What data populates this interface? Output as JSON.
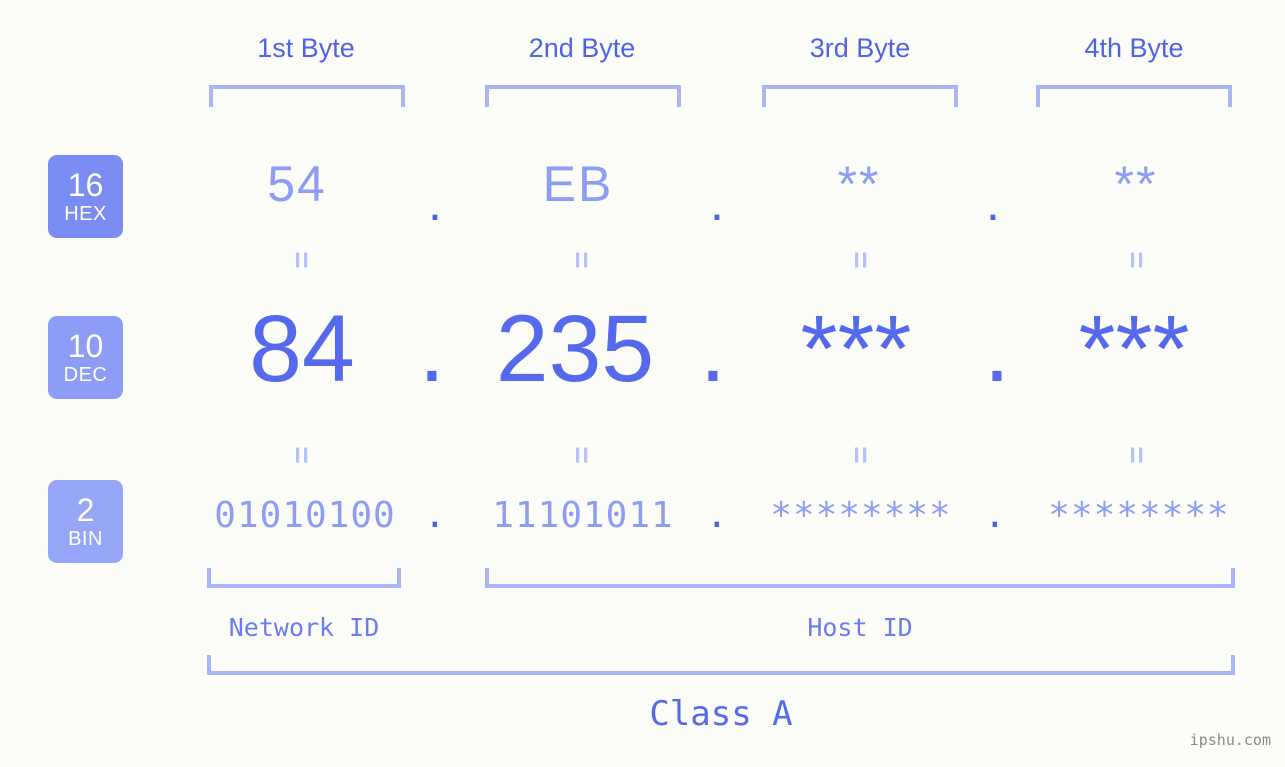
{
  "meta": {
    "background_color": "#fcfdf8",
    "accent_color": "#5569ec",
    "accent_light": "#8d9cf4",
    "bracket_color": "#aab4f7",
    "watermark": "ipshu.com"
  },
  "byte_headers": [
    {
      "label": "1st Byte"
    },
    {
      "label": "2nd Byte"
    },
    {
      "label": "3rd Byte"
    },
    {
      "label": "4th Byte"
    }
  ],
  "bases": [
    {
      "number": "16",
      "name": "HEX",
      "color": "#7b8cf2"
    },
    {
      "number": "10",
      "name": "DEC",
      "color": "#8d9cf4"
    },
    {
      "number": "2",
      "name": "BIN",
      "color": "#96a6f6"
    }
  ],
  "rows": {
    "hex": {
      "values": [
        "54",
        "EB",
        "**",
        "**"
      ],
      "separator": "."
    },
    "dec": {
      "values": [
        "84",
        "235",
        "***",
        "***"
      ],
      "separator": "."
    },
    "bin": {
      "values": [
        "01010100",
        "11101011",
        "********",
        "********"
      ],
      "separator": "."
    }
  },
  "equals_separator": "=",
  "segments": {
    "network_id": "Network ID",
    "host_id": "Host ID",
    "class": "Class A"
  }
}
